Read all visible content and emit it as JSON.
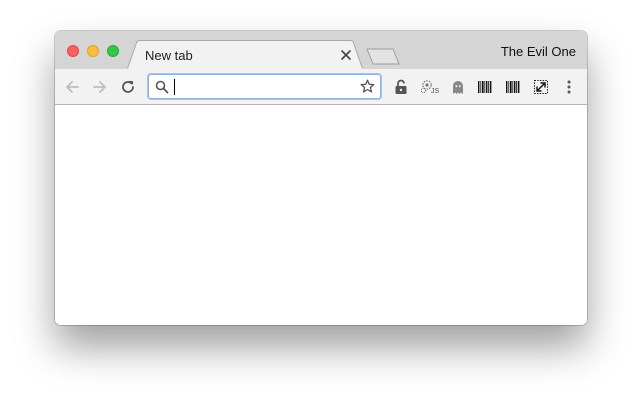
{
  "window": {
    "traffic_lights": {
      "close_color": "#fc605c",
      "minimize_color": "#fdbc40",
      "maximize_color": "#34c84a"
    },
    "profile_name": "The Evil One"
  },
  "tabs": [
    {
      "title": "New tab",
      "active": true,
      "close_icon": "close-icon"
    }
  ],
  "toolbar": {
    "back_icon": "back-arrow-icon",
    "forward_icon": "forward-arrow-icon",
    "reload_icon": "reload-icon",
    "omnibox": {
      "value": "",
      "search_icon": "search-icon",
      "bookmark_icon": "star-icon",
      "focus_color": "#8fb1e6"
    },
    "extensions": [
      {
        "name": "lock-extension",
        "icon": "unlocked-padlock-icon"
      },
      {
        "name": "js-extension",
        "icon": "gear-js-icon",
        "label": "JS"
      },
      {
        "name": "ghost-extension",
        "icon": "ghost-icon"
      },
      {
        "name": "barcode-extension-1",
        "icon": "barcode-icon"
      },
      {
        "name": "barcode-extension-2",
        "icon": "barcode-icon"
      },
      {
        "name": "expand-extension",
        "icon": "expand-icon"
      }
    ],
    "menu_icon": "more-vertical-icon"
  }
}
